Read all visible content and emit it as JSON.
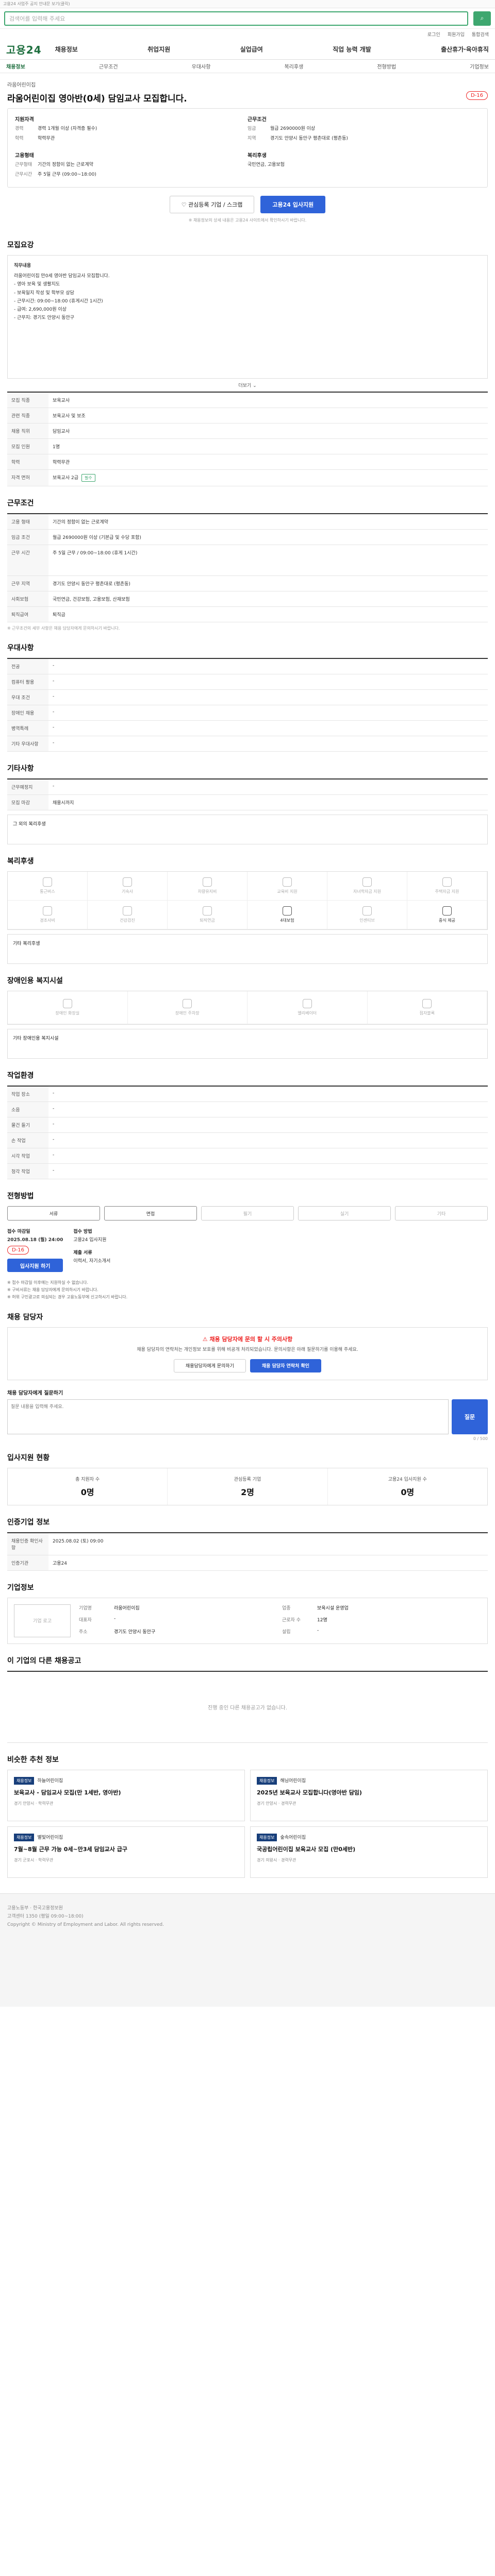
{
  "top": {
    "notice": "고용24 사업주 공지 안내문 보기(클릭)"
  },
  "search": {
    "placeholder": "검색어를 입력해 주세요"
  },
  "util": [
    "로그인",
    "회원가입",
    "통합검색"
  ],
  "gnb": {
    "logo": "고용24",
    "menu": [
      "채용정보",
      "취업지원",
      "실업급여",
      "직업 능력 개발",
      "출산휴가·육아휴직"
    ]
  },
  "subnav": [
    "채용정보",
    "근무조건",
    "우대사항",
    "복리후생",
    "전형방법",
    "기업정보"
  ],
  "job": {
    "company": "라움어린이집",
    "title": "라움어린이집 영아반(0세) 담임교사 모집합니다.",
    "dday": "D-16",
    "summary": {
      "left_h": "지원자격",
      "right_h": "근무조건",
      "left": [
        {
          "k": "경력",
          "v": "경력 1개월 이상 (자격증 필수)"
        },
        {
          "k": "학력",
          "v": "학력무관"
        }
      ],
      "right": [
        {
          "k": "임금",
          "v": "월급 2690000원 이상"
        },
        {
          "k": "지역",
          "v": "경기도 안양시 동안구 평촌대로 (평촌동)"
        }
      ],
      "left2_h": "고용형태",
      "right2_h": "복리후생",
      "left2": [
        {
          "k": "근무형태",
          "v": "기간의 정함이 없는 근로계약"
        },
        {
          "k": "근무시간",
          "v": "주 5일 근무 (09:00~18:00)"
        }
      ],
      "right2": [
        {
          "k": "",
          "v": "국민연금, 고용보험"
        }
      ]
    },
    "btn_scrap": "관심등록 기업 / 스크랩",
    "btn_apply": "고용24 입사지원",
    "notice": "※ 채용정보의 상세 내용은 고용24 사이트에서 확인하시기 바랍니다."
  },
  "sections": {
    "jobinfo": "모집요강",
    "conditions": "근무조건",
    "prefer": "우대사항",
    "other": "기타사항",
    "welfare": "복리후생",
    "disabled": "장애인용 복지시설",
    "env": "작업환경",
    "process": "전형방법",
    "contact": "채용 담당자",
    "stats": "입사지원 현황",
    "manager": "인증기업 정보",
    "company": "기업정보",
    "others": "이 기업의 다른 채용공고",
    "similar": "비슷한 추천 정보"
  },
  "jobbox": {
    "h": "직무내용",
    "lines": [
      "라움어린이집 만0세 영아반 담임교사 모집합니다.",
      "- 영아 보육 및 생활지도",
      "- 보육일지 작성 및 학부모 상담",
      "- 근무시간: 09:00~18:00 (휴게시간 1시간)",
      "- 급여: 2,690,000원 이상",
      "- 근무지: 경기도 안양시 동안구"
    ],
    "more": "더보기"
  },
  "info_rows": [
    {
      "k": "모집 직종",
      "v": "보육교사"
    },
    {
      "k": "관련 직종",
      "v": "보육교사 및 보조"
    },
    {
      "k": "채용 직위",
      "v": "담임교사"
    },
    {
      "k": "모집 인원",
      "v": "1명"
    },
    {
      "k": "학력",
      "v": "학력무관"
    },
    {
      "k": "자격 면허",
      "v": "보육교사 2급",
      "tag": "필수"
    }
  ],
  "cond_rows": [
    {
      "k": "고용 형태",
      "v": "기간의 정함이 없는 근로계약"
    },
    {
      "k": "임금 조건",
      "v": "월급 2690000원 이상 (기본급 및 수당 포함)"
    },
    {
      "k": "근무 시간",
      "v": "주 5일 근무 / 09:00~18:00 (휴게 1시간)"
    },
    {
      "k": "근무 지역",
      "v": "경기도 안양시 동안구 평촌대로 (평촌동)"
    },
    {
      "k": "사회보험",
      "v": "국민연금, 건강보험, 고용보험, 산재보험"
    },
    {
      "k": "퇴직급여",
      "v": "퇴직금"
    }
  ],
  "cond_note": "※ 근무조건의 세부 사항은 채용 담당자에게 문의하시기 바랍니다.",
  "prefer_rows": [
    {
      "k": "전공",
      "v": "-"
    },
    {
      "k": "컴퓨터 활용",
      "v": "-"
    },
    {
      "k": "우대 조건",
      "v": "-"
    },
    {
      "k": "장애인 채용",
      "v": "-"
    },
    {
      "k": "병역특례",
      "v": "-"
    },
    {
      "k": "기타 우대사항",
      "v": "-"
    }
  ],
  "other_rows": [
    {
      "k": "근무예정지",
      "v": "-"
    },
    {
      "k": "모집 마감",
      "v": "채용시까지"
    }
  ],
  "other_etc_h": "그 외의 복리후생",
  "welfare_items": [
    "통근버스",
    "기숙사",
    "차량유지비",
    "교육비 지원",
    "자녀학자금 지원",
    "주택자금 지원",
    "경조사비",
    "건강검진",
    "퇴직연금",
    "4대보험",
    "인센티브",
    "중식 제공"
  ],
  "welfare_on": [
    9,
    11
  ],
  "welfare_etc_h": "기타 복리후생",
  "disabled_items": [
    "장애인 화장실",
    "장애인 주차장",
    "엘리베이터",
    "점자블록"
  ],
  "disabled_etc_h": "기타 장애인용 복지시설",
  "env_rows": [
    {
      "k": "작업 장소",
      "v": "-"
    },
    {
      "k": "소음",
      "v": "-"
    },
    {
      "k": "물건 들기",
      "v": "-"
    },
    {
      "k": "손 작업",
      "v": "-"
    },
    {
      "k": "시각 작업",
      "v": "-"
    },
    {
      "k": "청각 작업",
      "v": "-"
    }
  ],
  "process_steps": [
    "서류",
    "면접",
    "필기",
    "실기",
    "기타"
  ],
  "process_on": [
    0,
    1
  ],
  "process": {
    "k1": "접수 마감일",
    "v1": "2025.08.18 (월) 24:00",
    "dday": "D-16",
    "k2": "접수 방법",
    "v2": "고용24 입사지원",
    "btn": "입사지원 하기",
    "k3": "제출 서류",
    "v3": "이력서, 자기소개서"
  },
  "bullets": [
    "※ 접수 마감일 이후에는 지원하실 수 없습니다.",
    "※ 구비서류는 채용 담당자에게 문의하시기 바랍니다.",
    "※ 허위 구인광고로 의심되는 경우 고용노동부에 신고하시기 바랍니다."
  ],
  "contact": {
    "warn": "채용 담당자에 문의 할 시 주의사항",
    "desc": "채용 담당자의 연락처는 개인정보 보호를 위해 비공개 처리되었습니다. 문의사항은 아래 질문하기를 이용해 주세요.",
    "b1": "채용담당자에게 문의하기",
    "b2": "채용 담당자 연락처 확인"
  },
  "qna": {
    "h": "채용 담당자에게 질문하기",
    "placeholder": "질문 내용을 입력해 주세요.",
    "btn": "질문",
    "count": "0 / 500"
  },
  "stats": [
    {
      "k": "총 지원자 수",
      "v": "0명"
    },
    {
      "k": "관심등록 기업",
      "v": "2명"
    },
    {
      "k": "고용24 입사지원 수",
      "v": "0명"
    }
  ],
  "manager_rows": [
    {
      "k": "채용인증 확인사항",
      "v": "2025.08.02 (토) 09:00"
    },
    {
      "k": "인증기관",
      "v": "고용24"
    }
  ],
  "company_info": {
    "logo": "기업 로고",
    "rows": [
      {
        "k": "기업명",
        "v": "라움어린이집"
      },
      {
        "k": "업종",
        "v": "보육시설 운영업"
      },
      {
        "k": "대표자",
        "v": "-"
      },
      {
        "k": "근로자 수",
        "v": "12명"
      },
      {
        "k": "주소",
        "v": "경기도 안양시 동안구"
      },
      {
        "k": "설립",
        "v": "-"
      }
    ]
  },
  "others_empty": "진행 중인 다른 채용공고가 없습니다.",
  "similar": [
    {
      "badge": "채용정보",
      "cn": "하늘어린이집",
      "t": "보육교사 - 담임교사 모집(만 1세반, 영아반)",
      "m": "경기 안양시 · 학력무관"
    },
    {
      "badge": "채용정보",
      "cn": "해님어린이집",
      "t": "2025년 보육교사 모집합니다(영아반 담임)",
      "m": "경기 안양시 · 경력무관"
    },
    {
      "badge": "채용정보",
      "cn": "별빛어린이집",
      "t": "7월~8월 근무 가능 0세~만3세 담임교사 급구",
      "m": "경기 군포시 · 학력무관"
    },
    {
      "badge": "채용정보",
      "cn": "숲속어린이집",
      "t": "국공립어린이집 보육교사 모집 (만0세반)",
      "m": "경기 의왕시 · 경력무관"
    }
  ],
  "footer": [
    "고용노동부 · 한국고용정보원",
    "고객센터 1350 (평일 09:00~18:00)",
    "Copyright © Ministry of Employment and Labor. All rights reserved."
  ]
}
